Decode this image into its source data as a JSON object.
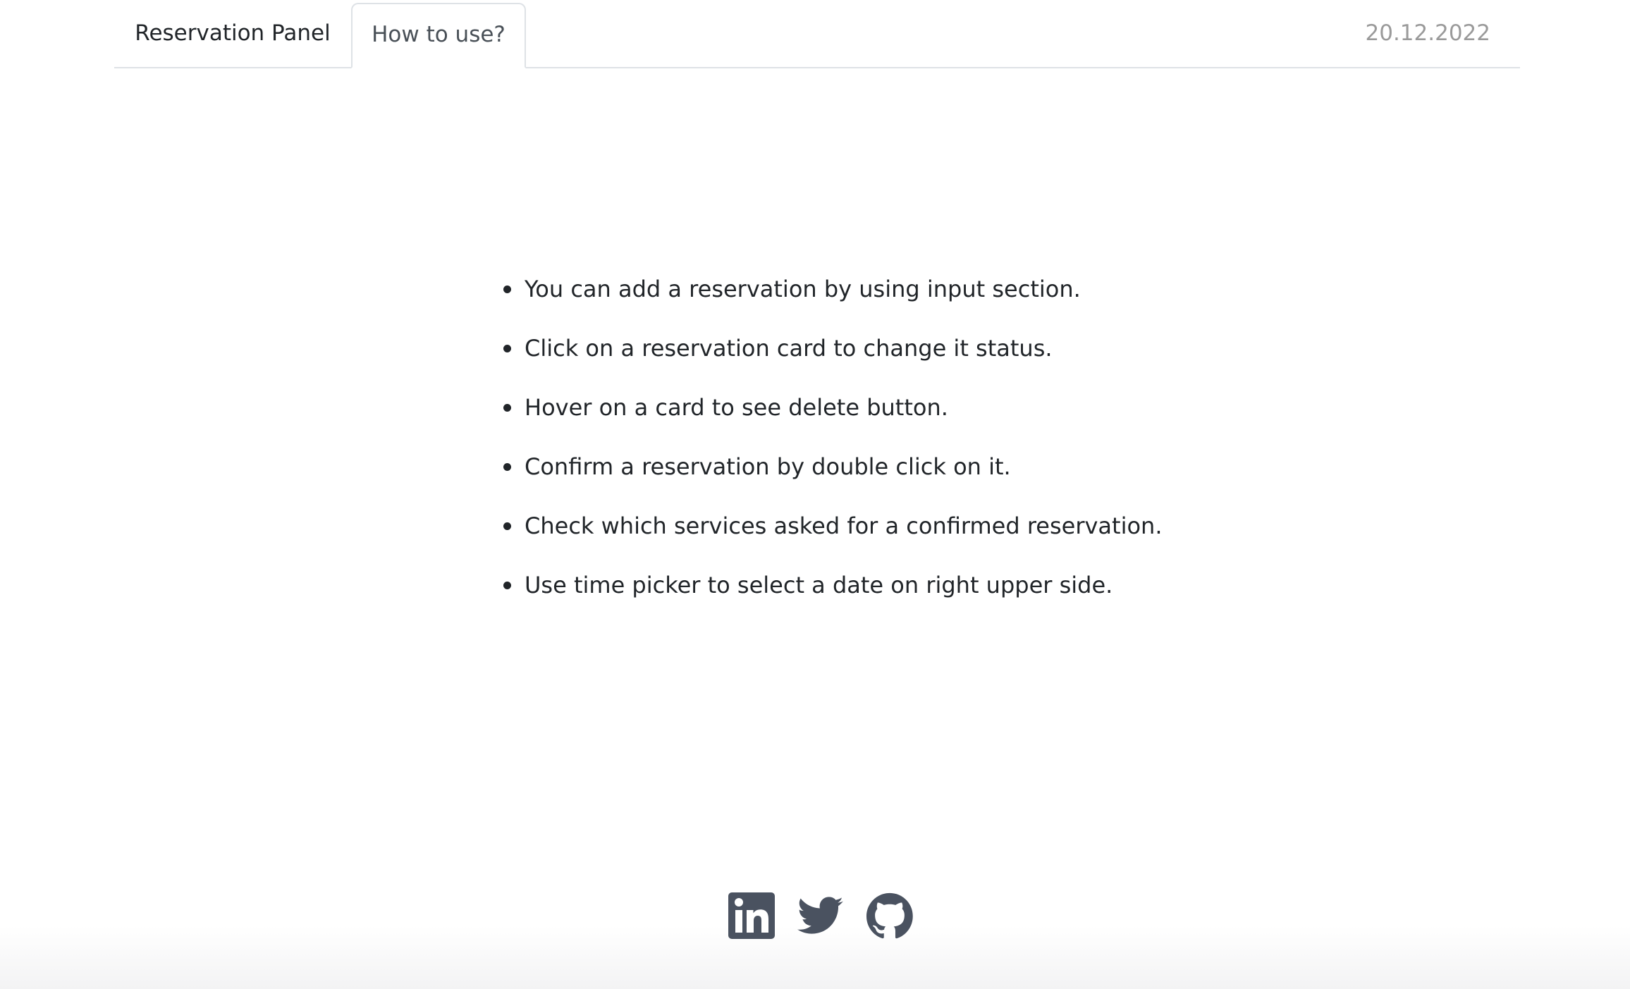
{
  "header": {
    "tabs": [
      {
        "label": "Reservation Panel",
        "active": false
      },
      {
        "label": "How to use?",
        "active": true
      }
    ],
    "date": "20.12.2022"
  },
  "instructions": [
    "You can add a reservation by using input section.",
    "Click on a reservation card to change it status.",
    "Hover on a card to see delete button.",
    "Confirm a reservation by double click on it.",
    "Check which services asked for a confirmed reservation.",
    "Use time picker to select a date on right upper side."
  ],
  "footer": {
    "social_icons": [
      "linkedin-icon",
      "twitter-icon",
      "github-icon"
    ],
    "icon_color": "#4a5260"
  }
}
